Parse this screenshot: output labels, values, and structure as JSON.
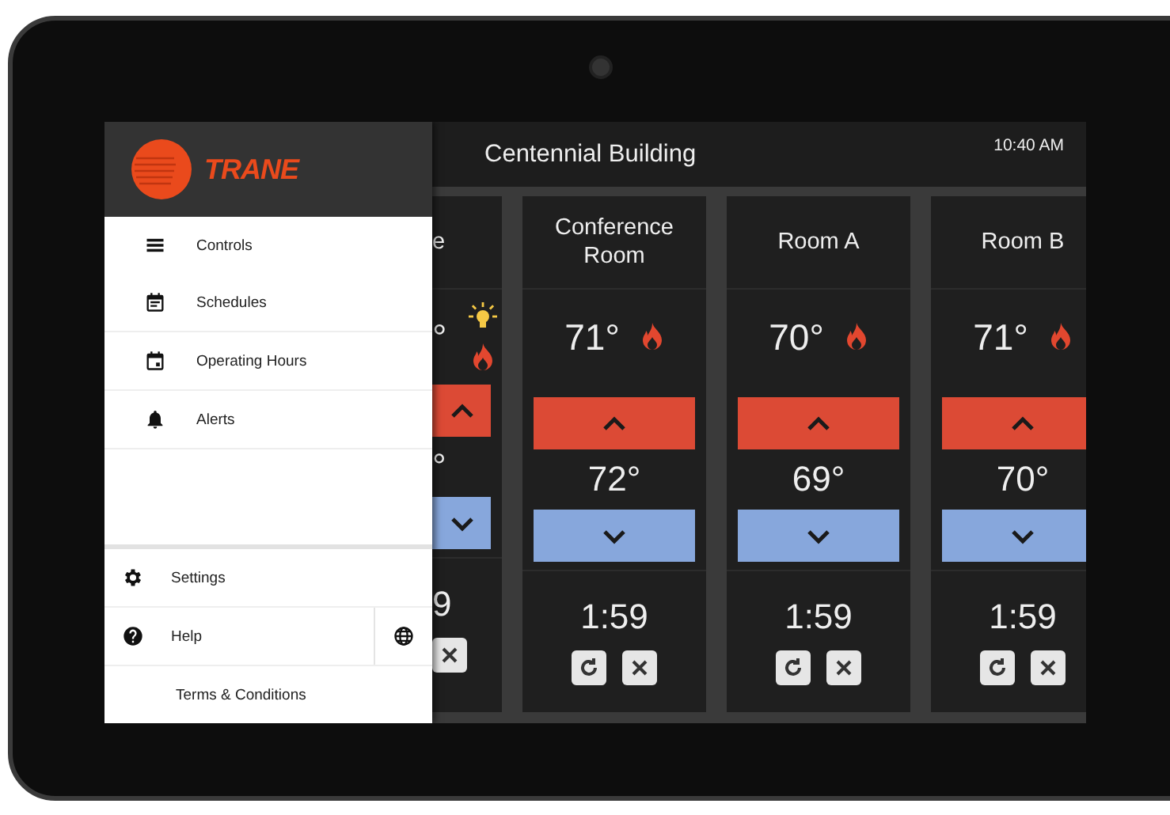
{
  "header": {
    "title": "Centennial Building",
    "time": "10:40 AM"
  },
  "drawer": {
    "logo": "TRANE",
    "items": [
      {
        "label": "Controls"
      },
      {
        "label": "Schedules"
      },
      {
        "label": "Operating Hours"
      },
      {
        "label": "Alerts"
      }
    ],
    "footer": [
      {
        "label": "Settings"
      },
      {
        "label": "Help"
      },
      {
        "label": "Terms & Conditions"
      }
    ]
  },
  "rooms": [
    {
      "kind": "partial",
      "name": "e",
      "temperature": "°",
      "setpoint": "°",
      "timer": "9",
      "light": true,
      "heating": true
    },
    {
      "kind": "full",
      "name": "Conference Room",
      "temperature": "71°",
      "setpoint": "72°",
      "timer": "1:59",
      "light": false,
      "heating": true
    },
    {
      "kind": "full",
      "name": "Room A",
      "temperature": "70°",
      "setpoint": "69°",
      "timer": "1:59",
      "light": false,
      "heating": true
    },
    {
      "kind": "full",
      "name": "Room B",
      "temperature": "71°",
      "setpoint": "70°",
      "timer": "1:59",
      "light": false,
      "heating": true
    }
  ]
}
